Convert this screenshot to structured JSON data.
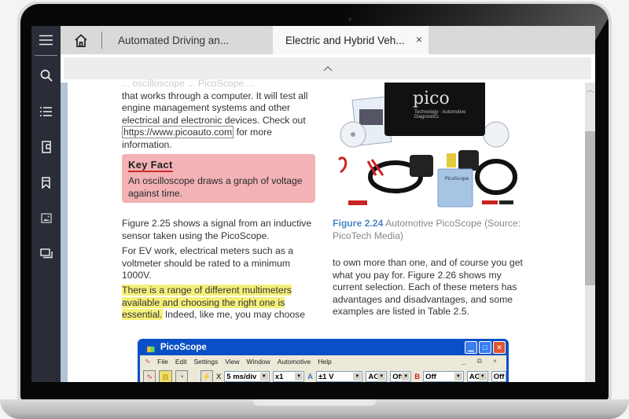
{
  "sidebar": {
    "items": [
      {
        "icon": "menu-icon",
        "label": "Menu"
      },
      {
        "icon": "search-icon",
        "label": "Search"
      },
      {
        "icon": "list-icon",
        "label": "Contents"
      },
      {
        "icon": "page-icon",
        "label": "Pages"
      },
      {
        "icon": "bookmark-icon",
        "label": "Bookmarks"
      },
      {
        "icon": "image-icon",
        "label": "Figures"
      },
      {
        "icon": "notes-icon",
        "label": "Notes"
      }
    ]
  },
  "tabs": [
    {
      "label": "Automated Driving an...",
      "active": false
    },
    {
      "label": "Electric and Hybrid Veh...",
      "active": true,
      "close": "×"
    }
  ],
  "collapse": {
    "icon": "chevron-up-icon",
    "glyph": "^"
  },
  "content": {
    "top_cut": "... oscilloscope ... PicoScope ...",
    "p1_before_link": "that works through a computer. It will test all engine management systems and other electrical and electronic devices. Check out ",
    "p1_link": "https://www.picoauto.com",
    "p1_after_link": " for more information.",
    "key_fact": {
      "title": "Key Fact",
      "body": "An oscilloscope draws a graph of voltage against time.",
      "color": "#f2b2b6"
    },
    "p_fig25": "Figure 2.25 shows a signal from an inductive sensor taken using the PicoScope.",
    "p_ev": "For EV work, electrical meters such as a voltmeter should be rated to a minimum 1000V.",
    "p_range_highlight": "There is a range of different multimeters available and choosing the right one is essential.",
    "p_range_rest": " Indeed, like me, you may choose",
    "figure_2_24": {
      "number": "Figure 2.24",
      "caption": "Automotive PicoScope (Source: PicoTech Media)",
      "logo": "pico",
      "logo_sub": "Technology · Automotive Diagnostics"
    },
    "p_right": "to own more than one, and of course you get what you pay for. Figure 2.26 shows my current selection. Each of these meters has advantages and disadvantages, and some examples are listed in Table 2.5."
  },
  "picoscope": {
    "title": "PicoScope",
    "menu": [
      "File",
      "Edit",
      "Settings",
      "View",
      "Window",
      "Automotive",
      "Help"
    ],
    "mdi_controls": "_ ⧉ ×",
    "toolbar": {
      "x_label": "X",
      "timebase": "5 ms/div",
      "zoom": "x1",
      "a_label": "A",
      "a_range": "±1 V",
      "a_coupling": "AC",
      "a_off": "Off",
      "b_label": "B",
      "b_range": "Off",
      "b_coupling": "AC",
      "b_off": "Off"
    }
  }
}
